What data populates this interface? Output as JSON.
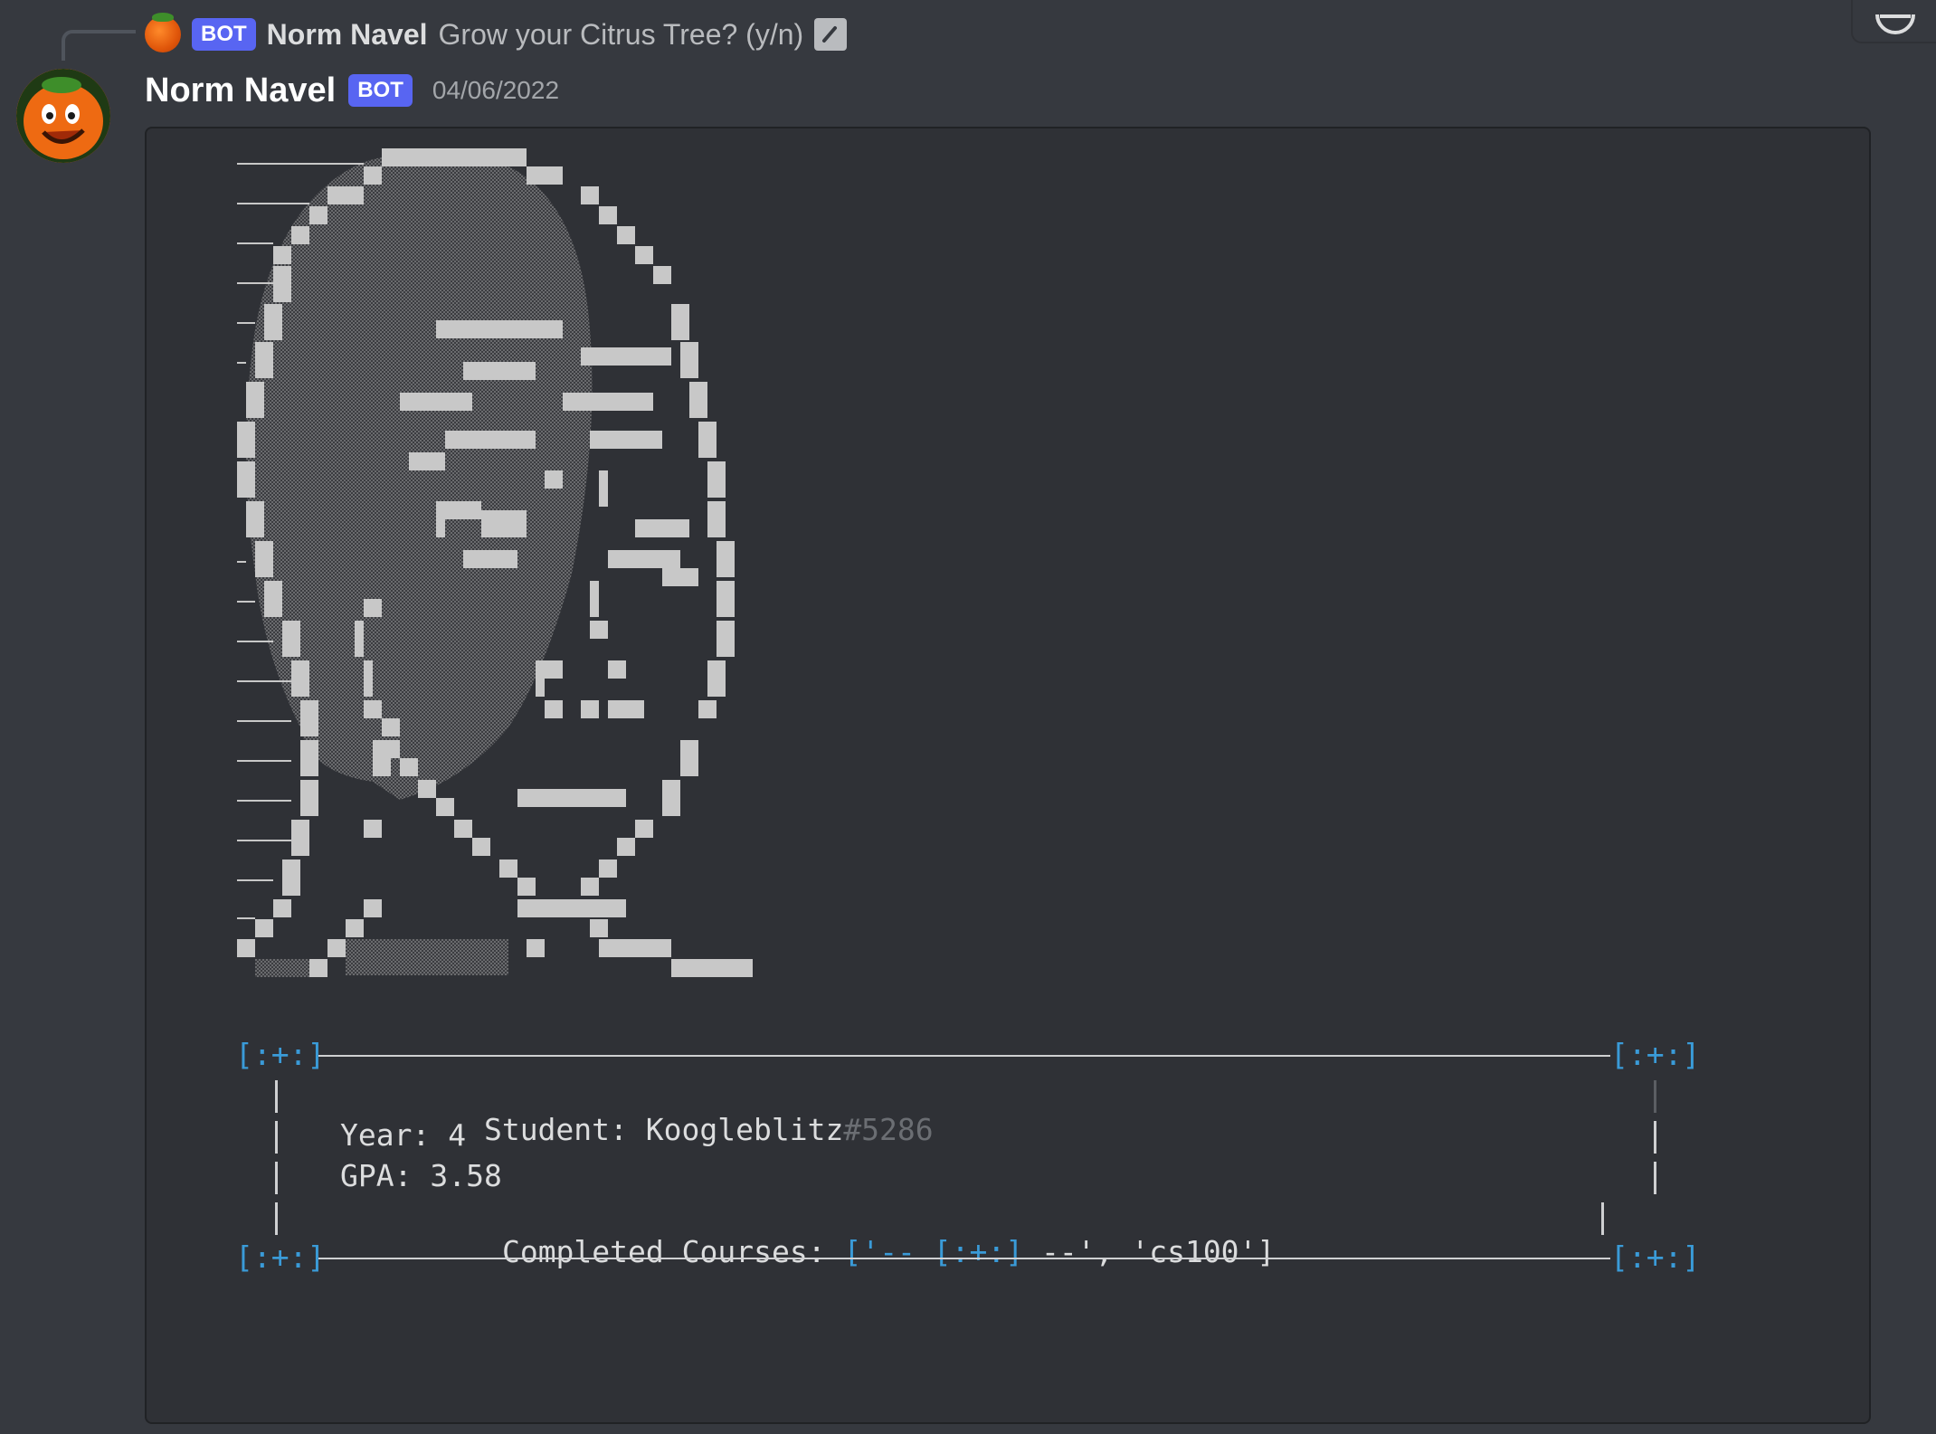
{
  "reply": {
    "bot_tag": "BOT",
    "author": "Norm Navel",
    "text": "Grow your Citrus Tree? (y/n)"
  },
  "message": {
    "author": "Norm Navel",
    "bot_tag": "BOT",
    "timestamp": "04/06/2022"
  },
  "panel": {
    "corner": "[:+:]",
    "student_label": "Student: ",
    "student_name": "Koogleblitz",
    "student_discriminator": "#5286",
    "year_line": "Year: 4",
    "gpa_line": "GPA: 3.58",
    "courses_label": "Completed Courses: ",
    "courses_open": "['-- ",
    "courses_bracket": "[:+:]",
    "courses_rest": " --', 'cs100']"
  },
  "colors": {
    "background": "#36393f",
    "codeblock": "#2f3136",
    "bot_tag": "#5865f2",
    "bracket": "#3a9bd8",
    "art_light": "#c8c8c8",
    "art_dark": "#5a5a5a"
  }
}
